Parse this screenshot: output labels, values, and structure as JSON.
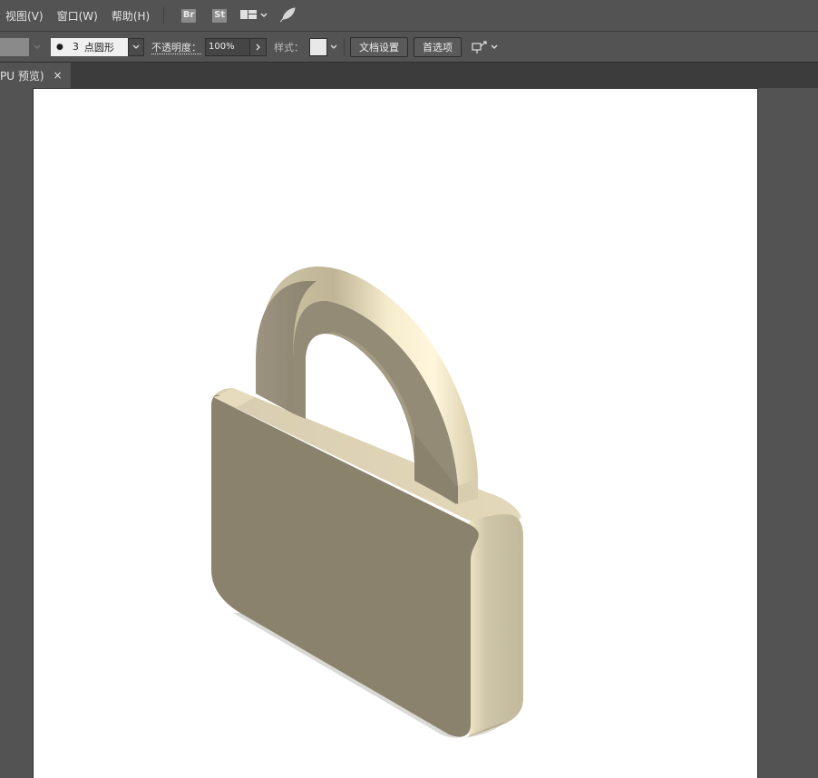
{
  "menubar": {
    "items": [
      {
        "label": "视图(V)"
      },
      {
        "label": "窗口(W)"
      },
      {
        "label": "帮助(H)"
      }
    ],
    "bridge_badge": "Br",
    "stock_badge": "St"
  },
  "controlbar": {
    "brush_size": "3",
    "brush_shape": "点圆形",
    "opacity_label": "不透明度：",
    "opacity_value": "100%",
    "style_label": "样式：",
    "doc_setup_button": "文档设置",
    "preferences_button": "首选项"
  },
  "tab": {
    "title": "PU 预览)",
    "close": "×"
  },
  "colors": {
    "panel": "#535353",
    "artboard": "#ffffff",
    "lock_front": "#8a826d",
    "lock_side": "#c6bea2",
    "lock_top": "#ddd2b4",
    "shackle_light": "#f3e9c8"
  },
  "icons": {
    "layout": "workspace-layout-icon",
    "publish": "send-feather-icon",
    "arrange": "arrange-documents-icon"
  }
}
